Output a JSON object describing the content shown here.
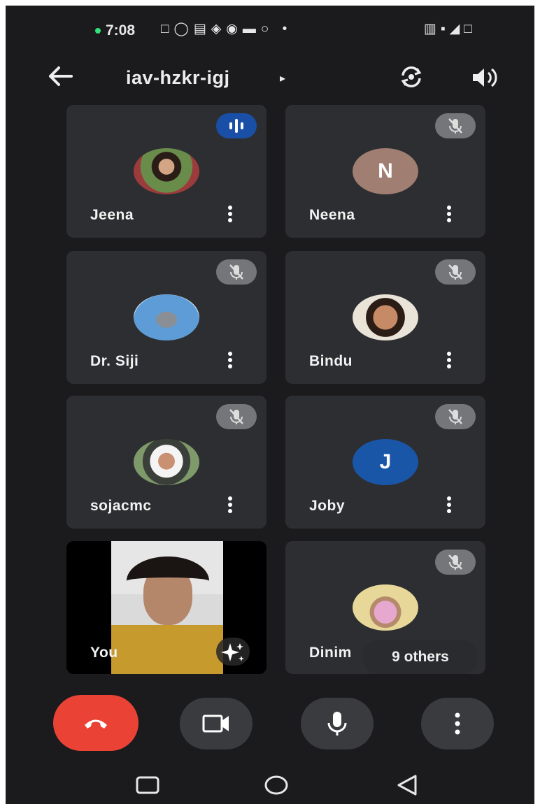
{
  "status_bar": {
    "time": "7:08",
    "icons": "□◯▤◈◉▬○ •",
    "right_icons": "▥▪◢□"
  },
  "top_bar": {
    "meeting_code": "iav-hzkr-igj",
    "caret": "▸"
  },
  "participants": [
    {
      "name": "Jeena",
      "avatar": "photo",
      "state": "speaking"
    },
    {
      "name": "Neena",
      "avatar": "letter",
      "initial": "N",
      "avatar_color": "#a07e72",
      "state": "muted"
    },
    {
      "name": "Dr. Siji",
      "avatar": "photo",
      "state": "muted"
    },
    {
      "name": "Bindu",
      "avatar": "photo",
      "state": "muted"
    },
    {
      "name": "sojacmc",
      "avatar": "photo",
      "state": "muted"
    },
    {
      "name": "Joby",
      "avatar": "letter",
      "initial": "J",
      "avatar_color": "#1a56a8",
      "state": "muted"
    },
    {
      "name": "You",
      "avatar": "video",
      "state": "self"
    },
    {
      "name": "Dinim",
      "avatar": "photo",
      "state": "muted"
    }
  ],
  "others_label": "9 others",
  "colors": {
    "hangup": "#ea4335",
    "speaking": "#1a4fa8",
    "muted_badge": "#75767a",
    "tile": "#2d2e31"
  },
  "controls": [
    "hang-up",
    "camera",
    "microphone",
    "more-options"
  ],
  "nav": [
    "recents",
    "home",
    "back"
  ]
}
